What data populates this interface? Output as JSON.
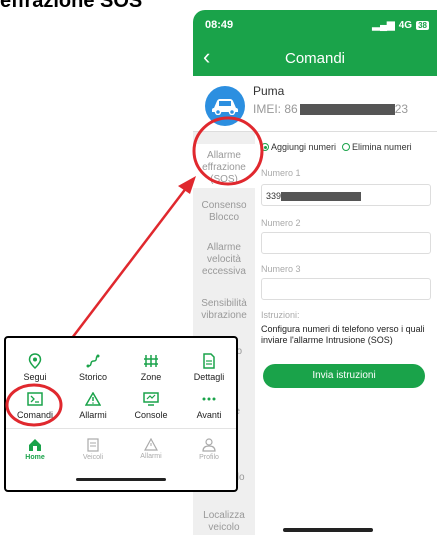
{
  "caption": "effrazione SOS",
  "status": {
    "time": "08:49",
    "network": "4G",
    "battery": "38"
  },
  "nav": {
    "title": "Comandi"
  },
  "vehicle": {
    "name": "Puma",
    "imei_prefix": "IMEI: 86",
    "imei_suffix": "23"
  },
  "sidebar": {
    "items": [
      {
        "label": "Allarme effrazione (SOS)"
      },
      {
        "label": "Consenso Blocco"
      },
      {
        "label": "Allarme velocità eccessiva"
      },
      {
        "label": "Sensibilità vibrazione"
      },
      {
        "label": "...mento"
      },
      {
        "label": "...zione"
      },
      {
        "label": "...arm"
      },
      {
        "label": "... da ...lo"
      },
      {
        "label": "Localizza veicolo"
      }
    ]
  },
  "form": {
    "radio_add": "Aggiungi numeri",
    "radio_remove": "Elimina numeri",
    "label1": "Numero 1",
    "value1_prefix": "339",
    "label2": "Numero 2",
    "label3": "Numero 3",
    "instr_label": "Istruzioni:",
    "instr_text": "Configura numeri di telefono verso i quali inviare l'allarme Intrusione (SOS)",
    "send": "Invia istruzioni"
  },
  "zoom": {
    "tiles": [
      {
        "label": "Segui"
      },
      {
        "label": "Storico"
      },
      {
        "label": "Zone"
      },
      {
        "label": "Dettagli"
      },
      {
        "label": "Comandi"
      },
      {
        "label": "Allarmi"
      },
      {
        "label": "Console"
      },
      {
        "label": "Avanti"
      }
    ],
    "tabs": [
      {
        "label": "Home"
      },
      {
        "label": "Veicoli"
      },
      {
        "label": "Allarmi"
      },
      {
        "label": "Profilo"
      }
    ]
  },
  "colors": {
    "accent": "#1aa34a",
    "annotation": "#e0282e",
    "car": "#2c8fe0"
  }
}
